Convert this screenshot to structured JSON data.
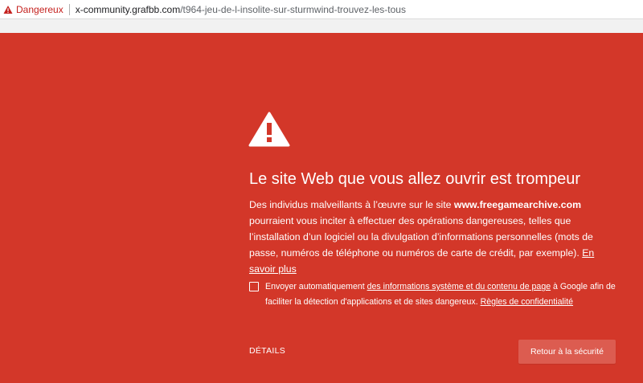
{
  "address_bar": {
    "security_label": "Dangereux",
    "url_host": "x-community.grafbb.com",
    "url_path": "/t964-jeu-de-l-insolite-sur-sturmwind-trouvez-les-tous"
  },
  "interstitial": {
    "title": "Le site Web que vous allez ouvrir est trompeur",
    "body_part1": "Des individus malveillants à l’œuvre sur le site ",
    "body_site": "www.freegamearchive.com",
    "body_part2": " pourraient vous inciter à effectuer des opérations dangereuses, telles que l’installation d’un logiciel ou la divulgation d’informations personnelles (mots de passe, numéros de téléphone ou numéros de carte de crédit, par exemple). ",
    "learn_more_link": "En savoir plus",
    "optin_part1": "Envoyer automatiquement ",
    "optin_link": "des informations système et du contenu de page",
    "optin_part2": " à Google afin de faciliter la détection d'applications et de sites dangereux. ",
    "privacy_link": "Règles de confidentialité",
    "details_button": "DÉTAILS",
    "back_button": "Retour à la sécurité"
  },
  "colors": {
    "background": "#d33729",
    "button": "#dc5c50",
    "danger_text": "#c5221f"
  },
  "icons": {
    "address_bar": "warning-triangle-icon",
    "main": "warning-triangle-icon"
  }
}
